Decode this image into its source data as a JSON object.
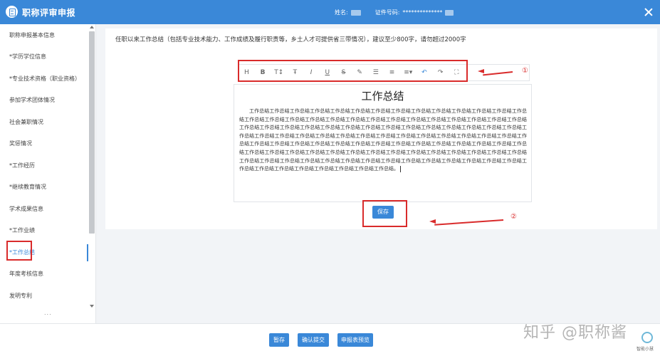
{
  "header": {
    "title": "职称评审申报",
    "name_label": "姓名:",
    "id_label": "证件号码:",
    "id_value": "**************"
  },
  "sidebar": {
    "items": [
      {
        "label": "职称申报基本信息",
        "active": false
      },
      {
        "label": "*学历学位信息",
        "active": false
      },
      {
        "label": "*专业技术资格（职业资格）",
        "active": false
      },
      {
        "label": "参加学术团体情况",
        "active": false
      },
      {
        "label": "社会兼职情况",
        "active": false
      },
      {
        "label": "奖惩情况",
        "active": false
      },
      {
        "label": "*工作经历",
        "active": false
      },
      {
        "label": "*继续教育情况",
        "active": false
      },
      {
        "label": "学术成果信息",
        "active": false
      },
      {
        "label": "*工作业绩",
        "active": false
      },
      {
        "label": "*工作总结",
        "active": true
      },
      {
        "label": "年度考核信息",
        "active": false
      },
      {
        "label": "发明专利",
        "active": false
      }
    ],
    "more": "..."
  },
  "main": {
    "instruction": "任职以来工作总结（包括专业技术能力、工作成绩及履行职责等，乡土人才可提供省三带情况），建议至少800字，请勿超过2000字",
    "toolbar": [
      {
        "glyph": "H",
        "icon": "heading-icon"
      },
      {
        "glyph": "B",
        "icon": "bold-icon"
      },
      {
        "glyph": "T↕",
        "icon": "font-size-icon"
      },
      {
        "glyph": "Ŧ",
        "icon": "font-family-icon"
      },
      {
        "glyph": "I",
        "icon": "italic-icon"
      },
      {
        "glyph": "U",
        "icon": "underline-icon"
      },
      {
        "glyph": "S",
        "icon": "strikethrough-icon"
      },
      {
        "glyph": "✎",
        "icon": "highlight-icon"
      },
      {
        "glyph": "☰",
        "icon": "bullet-list-icon"
      },
      {
        "glyph": "≡",
        "icon": "align-icon"
      },
      {
        "glyph": "≡▾",
        "icon": "line-height-icon"
      },
      {
        "glyph": "↶",
        "icon": "undo-icon"
      },
      {
        "glyph": "↷",
        "icon": "redo-icon"
      },
      {
        "glyph": "⛶",
        "icon": "fullscreen-icon"
      }
    ],
    "document_title": "工作总结",
    "document_body": "工作总结工作总结工作总结工作总结工作总结工作总结工作总结工作总结工作总结工作总结工作总结工作总结工作总结工作总结工作总结工作总结工作总结工作总结工作总结工作总结工作总结工作总结工作总结工作总结工作总结工作总结工作总结工作总结工作总结工作总结工作总结工作总结工作总结工作总结工作总结工作总结工作总结工作总结工作总结工作总结工作总结工作总结工作总结工作总结工作总结工作总结工作总结工作总结工作总结工作总结工作总结工作总结工作总结工作总结工作总结工作总结工作总结工作总结工作总结工作总结工作总结工作总结工作总结工作总结工作总结工作总结工作总结工作总结工作总结工作总结工作总结工作总结工作总结工作总结工作总结工作总结工作总结工作总结工作总结工作总结工作总结工作总结工作总结工作总结工作总结工作总结工作总结工作总结工作总结工作总结工作总结工作总结工作总结工作总结工作总结工作总结工作总结工作总结工作总结工作总结工作总结工作总结工作总结工作总结工作总结工作总结工作总结。",
    "save_label": "保存"
  },
  "annotations": {
    "marker_1": "①",
    "marker_2": "②",
    "color": "#d92b2b"
  },
  "footer": {
    "draft_label": "暂存",
    "submit_label": "确认提交",
    "preview_label": "申报表预览"
  },
  "watermark": "知乎 @职称酱",
  "widget_label": "智能小慧",
  "colors": {
    "primary": "#3a88d8",
    "annotation": "#d92b2b"
  }
}
